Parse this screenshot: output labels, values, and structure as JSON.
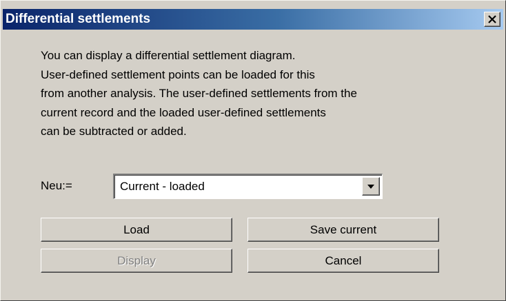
{
  "window": {
    "title": "Differential settlements",
    "close_icon": "close-icon"
  },
  "description": {
    "lines": [
      "You can display a differential settlement diagram.",
      "User-defined settlement points can be loaded for this",
      "from another analysis. The user-defined settlements from the",
      "current record and the loaded user-defined settlements",
      "can be subtracted or added."
    ]
  },
  "neu": {
    "label": "Neu:=",
    "selected": "Current - loaded",
    "dropdown_icon": "chevron-down-icon"
  },
  "buttons": {
    "load": "Load",
    "save_current": "Save current",
    "display": "Display",
    "cancel": "Cancel"
  },
  "states": {
    "display_enabled": false
  }
}
